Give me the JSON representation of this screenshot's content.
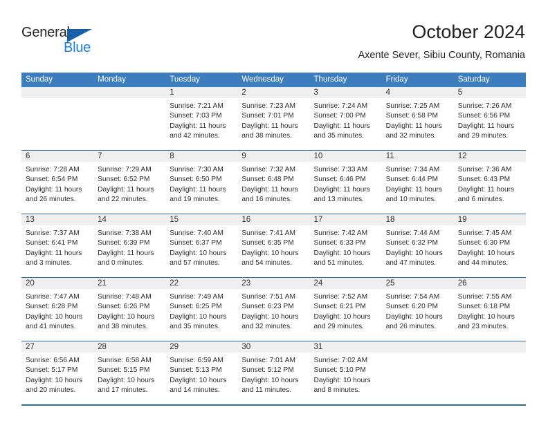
{
  "brand": {
    "name_part1": "General",
    "name_part2": "Blue",
    "triangle_color": "#1761aa",
    "blue_color": "#1b7fd4"
  },
  "header": {
    "title": "October 2024",
    "subtitle": "Axente Sever, Sibiu County, Romania"
  },
  "theme": {
    "header_row_bg": "#3b7dbd",
    "header_row_text": "#ffffff",
    "week_divider": "#2a6ca8",
    "daynum_band_bg": "#efefef",
    "body_text": "#2b2b2b"
  },
  "calendar": {
    "weekday_headers": [
      "Sunday",
      "Monday",
      "Tuesday",
      "Wednesday",
      "Thursday",
      "Friday",
      "Saturday"
    ],
    "weeks": [
      [
        {
          "day": "",
          "info": ""
        },
        {
          "day": "",
          "info": ""
        },
        {
          "day": "1",
          "info": "Sunrise: 7:21 AM\nSunset: 7:03 PM\nDaylight: 11 hours\nand 42 minutes."
        },
        {
          "day": "2",
          "info": "Sunrise: 7:23 AM\nSunset: 7:01 PM\nDaylight: 11 hours\nand 38 minutes."
        },
        {
          "day": "3",
          "info": "Sunrise: 7:24 AM\nSunset: 7:00 PM\nDaylight: 11 hours\nand 35 minutes."
        },
        {
          "day": "4",
          "info": "Sunrise: 7:25 AM\nSunset: 6:58 PM\nDaylight: 11 hours\nand 32 minutes."
        },
        {
          "day": "5",
          "info": "Sunrise: 7:26 AM\nSunset: 6:56 PM\nDaylight: 11 hours\nand 29 minutes."
        }
      ],
      [
        {
          "day": "6",
          "info": "Sunrise: 7:28 AM\nSunset: 6:54 PM\nDaylight: 11 hours\nand 26 minutes."
        },
        {
          "day": "7",
          "info": "Sunrise: 7:29 AM\nSunset: 6:52 PM\nDaylight: 11 hours\nand 22 minutes."
        },
        {
          "day": "8",
          "info": "Sunrise: 7:30 AM\nSunset: 6:50 PM\nDaylight: 11 hours\nand 19 minutes."
        },
        {
          "day": "9",
          "info": "Sunrise: 7:32 AM\nSunset: 6:48 PM\nDaylight: 11 hours\nand 16 minutes."
        },
        {
          "day": "10",
          "info": "Sunrise: 7:33 AM\nSunset: 6:46 PM\nDaylight: 11 hours\nand 13 minutes."
        },
        {
          "day": "11",
          "info": "Sunrise: 7:34 AM\nSunset: 6:44 PM\nDaylight: 11 hours\nand 10 minutes."
        },
        {
          "day": "12",
          "info": "Sunrise: 7:36 AM\nSunset: 6:43 PM\nDaylight: 11 hours\nand 6 minutes."
        }
      ],
      [
        {
          "day": "13",
          "info": "Sunrise: 7:37 AM\nSunset: 6:41 PM\nDaylight: 11 hours\nand 3 minutes."
        },
        {
          "day": "14",
          "info": "Sunrise: 7:38 AM\nSunset: 6:39 PM\nDaylight: 11 hours\nand 0 minutes."
        },
        {
          "day": "15",
          "info": "Sunrise: 7:40 AM\nSunset: 6:37 PM\nDaylight: 10 hours\nand 57 minutes."
        },
        {
          "day": "16",
          "info": "Sunrise: 7:41 AM\nSunset: 6:35 PM\nDaylight: 10 hours\nand 54 minutes."
        },
        {
          "day": "17",
          "info": "Sunrise: 7:42 AM\nSunset: 6:33 PM\nDaylight: 10 hours\nand 51 minutes."
        },
        {
          "day": "18",
          "info": "Sunrise: 7:44 AM\nSunset: 6:32 PM\nDaylight: 10 hours\nand 47 minutes."
        },
        {
          "day": "19",
          "info": "Sunrise: 7:45 AM\nSunset: 6:30 PM\nDaylight: 10 hours\nand 44 minutes."
        }
      ],
      [
        {
          "day": "20",
          "info": "Sunrise: 7:47 AM\nSunset: 6:28 PM\nDaylight: 10 hours\nand 41 minutes."
        },
        {
          "day": "21",
          "info": "Sunrise: 7:48 AM\nSunset: 6:26 PM\nDaylight: 10 hours\nand 38 minutes."
        },
        {
          "day": "22",
          "info": "Sunrise: 7:49 AM\nSunset: 6:25 PM\nDaylight: 10 hours\nand 35 minutes."
        },
        {
          "day": "23",
          "info": "Sunrise: 7:51 AM\nSunset: 6:23 PM\nDaylight: 10 hours\nand 32 minutes."
        },
        {
          "day": "24",
          "info": "Sunrise: 7:52 AM\nSunset: 6:21 PM\nDaylight: 10 hours\nand 29 minutes."
        },
        {
          "day": "25",
          "info": "Sunrise: 7:54 AM\nSunset: 6:20 PM\nDaylight: 10 hours\nand 26 minutes."
        },
        {
          "day": "26",
          "info": "Sunrise: 7:55 AM\nSunset: 6:18 PM\nDaylight: 10 hours\nand 23 minutes."
        }
      ],
      [
        {
          "day": "27",
          "info": "Sunrise: 6:56 AM\nSunset: 5:17 PM\nDaylight: 10 hours\nand 20 minutes."
        },
        {
          "day": "28",
          "info": "Sunrise: 6:58 AM\nSunset: 5:15 PM\nDaylight: 10 hours\nand 17 minutes."
        },
        {
          "day": "29",
          "info": "Sunrise: 6:59 AM\nSunset: 5:13 PM\nDaylight: 10 hours\nand 14 minutes."
        },
        {
          "day": "30",
          "info": "Sunrise: 7:01 AM\nSunset: 5:12 PM\nDaylight: 10 hours\nand 11 minutes."
        },
        {
          "day": "31",
          "info": "Sunrise: 7:02 AM\nSunset: 5:10 PM\nDaylight: 10 hours\nand 8 minutes."
        },
        {
          "day": "",
          "info": ""
        },
        {
          "day": "",
          "info": ""
        }
      ]
    ]
  }
}
